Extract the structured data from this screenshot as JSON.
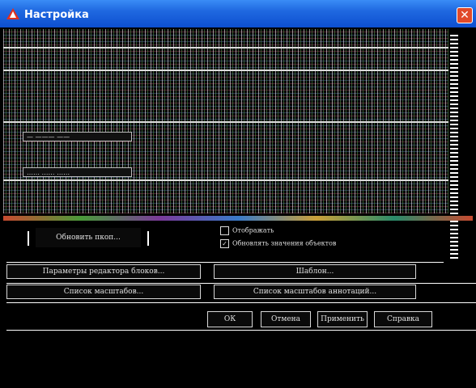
{
  "window": {
    "title": "Настройка",
    "icon": "autocad-icon",
    "close_label": "✕"
  },
  "corrupted_area": {
    "field_1": "—  ——— ——",
    "field_2": "……  ……  ……"
  },
  "buttons_row1": {
    "install": "Обновить пкоп...",
    "checkbox_1": "Отображать",
    "checkbox_2": "Обновлять значения объектов"
  },
  "buttons_row2": {
    "left": "Параметры редактора блоков...",
    "right": "Шаблон..."
  },
  "buttons_row3": {
    "left": "Список масштабов...",
    "right": "Список масштабов аннотаций..."
  },
  "dialog_buttons": {
    "ok": "ОК",
    "cancel": "Отмена",
    "apply": "Применить",
    "help": "Справка"
  }
}
